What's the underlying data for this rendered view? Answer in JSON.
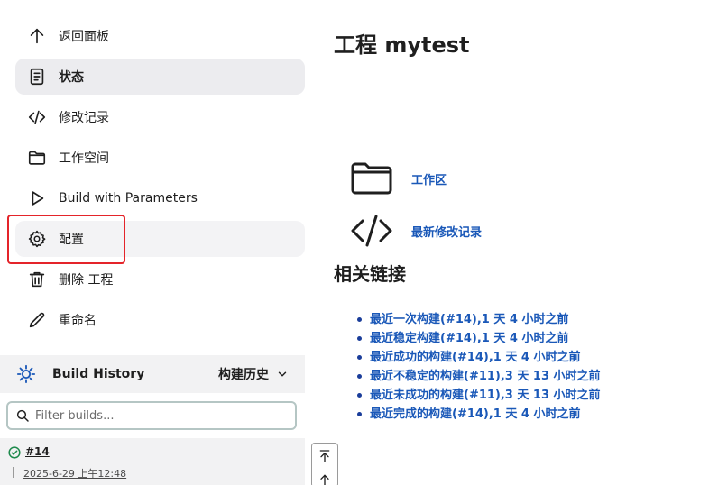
{
  "sidebar": {
    "items": [
      {
        "label": "返回面板",
        "icon": "arrow-up-icon"
      },
      {
        "label": "状态",
        "icon": "document-icon"
      },
      {
        "label": "修改记录",
        "icon": "code-icon"
      },
      {
        "label": "工作空间",
        "icon": "folder-icon"
      },
      {
        "label": "Build with Parameters",
        "icon": "play-icon"
      },
      {
        "label": "配置",
        "icon": "gear-icon"
      },
      {
        "label": "删除 工程",
        "icon": "trash-icon"
      },
      {
        "label": "重命名",
        "icon": "pencil-icon"
      }
    ]
  },
  "build_history": {
    "title": "Build History",
    "trend_label": "构建历史",
    "filter_placeholder": "Filter builds...",
    "builds": [
      {
        "number": "#14",
        "date": "2025-6-29 上午12:48",
        "status": "success"
      }
    ]
  },
  "main": {
    "title": "工程 mytest",
    "workspace_link": "工作区",
    "changes_link": "最新修改记录",
    "related_title": "相关链接",
    "related_links": [
      "最近一次构建(#14),1 天 4 小时之前",
      "最近稳定构建(#14),1 天 4 小时之前",
      "最近成功的构建(#14),1 天 4 小时之前",
      "最近不稳定的构建(#11),3 天 13 小时之前",
      "最近未成功的构建(#11),3 天 13 小时之前",
      "最近完成的构建(#14),1 天 4 小时之前"
    ]
  },
  "colors": {
    "link": "#1a58b8",
    "highlight": "#e4242a",
    "active_bg": "#ececef",
    "success": "#1e8a4c"
  }
}
